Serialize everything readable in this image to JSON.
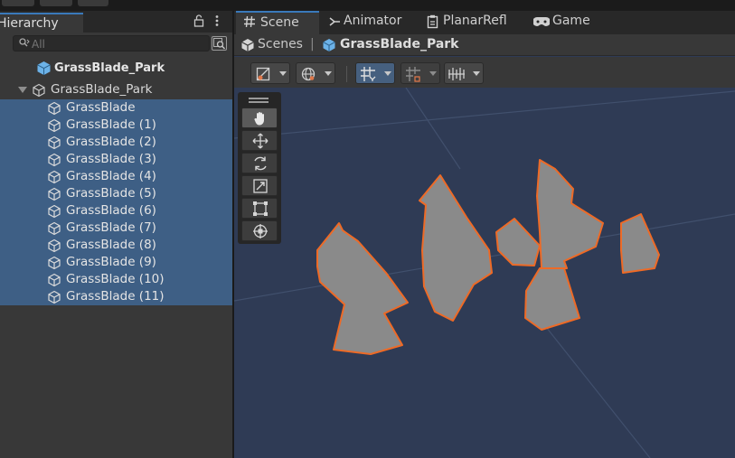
{
  "hierarchy": {
    "tab_title": "Hierarchy",
    "search": {
      "placeholder": "All",
      "value": ""
    },
    "scene": {
      "name": "GrassBlade_Park"
    },
    "root": {
      "name": "GrassBlade_Park",
      "expanded": true
    },
    "children": [
      {
        "name": "GrassBlade",
        "selected": true
      },
      {
        "name": "GrassBlade (1)",
        "selected": true
      },
      {
        "name": "GrassBlade (2)",
        "selected": true
      },
      {
        "name": "GrassBlade (3)",
        "selected": true
      },
      {
        "name": "GrassBlade (4)",
        "selected": true
      },
      {
        "name": "GrassBlade (5)",
        "selected": true
      },
      {
        "name": "GrassBlade (6)",
        "selected": true
      },
      {
        "name": "GrassBlade (7)",
        "selected": true
      },
      {
        "name": "GrassBlade (8)",
        "selected": true
      },
      {
        "name": "GrassBlade (9)",
        "selected": true
      },
      {
        "name": "GrassBlade (10)",
        "selected": true
      },
      {
        "name": "GrassBlade (11)",
        "selected": true
      }
    ]
  },
  "scene_view": {
    "tabs": [
      {
        "label": "Scene",
        "icon": "hash-icon",
        "active": true
      },
      {
        "label": "Animator",
        "icon": "animator-icon",
        "active": false
      },
      {
        "label": "PlanarRefl",
        "icon": "inspector-icon",
        "active": false
      },
      {
        "label": "Game",
        "icon": "gamepad-icon",
        "active": false
      }
    ],
    "breadcrumb": {
      "root": "Scenes",
      "separator": "|",
      "current": "GrassBlade_Park"
    },
    "toolbar": [
      "draw-mode-dropdown",
      "global-pivot-dropdown",
      "grid-snapping-dropdown",
      "increment-snap-dropdown",
      "gizmo-overlay-dropdown"
    ],
    "tools": [
      "hand-tool",
      "move-tool",
      "rotate-tool",
      "scale-tool",
      "rect-tool",
      "transform-tool"
    ],
    "active_tool": "hand-tool"
  },
  "colors": {
    "selection": "#3e5f85",
    "accent": "#3a79bb",
    "scene_background": "#2f3b55",
    "blade_fill": "#8a8a8a",
    "blade_outline": "#ee6a26",
    "prefab_icon": "#6cb2e8"
  }
}
